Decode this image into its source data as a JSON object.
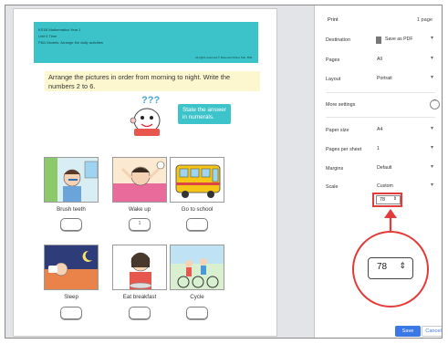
{
  "worksheet": {
    "header_line1": "KS1B Mathematics Year 1",
    "header_line2": "Unit 5 Time",
    "header_line3": "P&D Models: Arrange the daily activities",
    "header_rights": "All rights reserved © Ravenell Online Sdn. Bhd.",
    "instruction": "Arrange the pictures in order from morning to night. Write the numbers 2 to 6.",
    "mascot_text": "???",
    "answer_note": "State the answer in numerals.",
    "items": [
      {
        "caption": "Brush teeth",
        "answer": ""
      },
      {
        "caption": "Wake up",
        "answer": "1"
      },
      {
        "caption": "Go to school",
        "answer": ""
      },
      {
        "caption": "Sleep",
        "answer": ""
      },
      {
        "caption": "Eat breakfast",
        "answer": ""
      },
      {
        "caption": "Cycle",
        "answer": ""
      }
    ]
  },
  "print_panel": {
    "title": "Print",
    "page_count": "1 page",
    "destination_label": "Destination",
    "destination_value": "Save as PDF",
    "pages_label": "Pages",
    "pages_value": "All",
    "layout_label": "Layout",
    "layout_value": "Portrait",
    "more_settings_label": "More settings",
    "paper_size_label": "Paper size",
    "paper_size_value": "A4",
    "pages_per_sheet_label": "Pages per sheet",
    "pages_per_sheet_value": "1",
    "margins_label": "Margins",
    "margins_value": "Default",
    "scale_label": "Scale",
    "scale_value": "Custom",
    "scale_input": "78",
    "save_label": "Save",
    "cancel_label": "Cancel"
  },
  "colors": {
    "header_teal": "#3cc3c9",
    "instruction_bg": "#fdf7cf",
    "highlight_red": "#e33b39",
    "accent_blue": "#3b78e7"
  }
}
